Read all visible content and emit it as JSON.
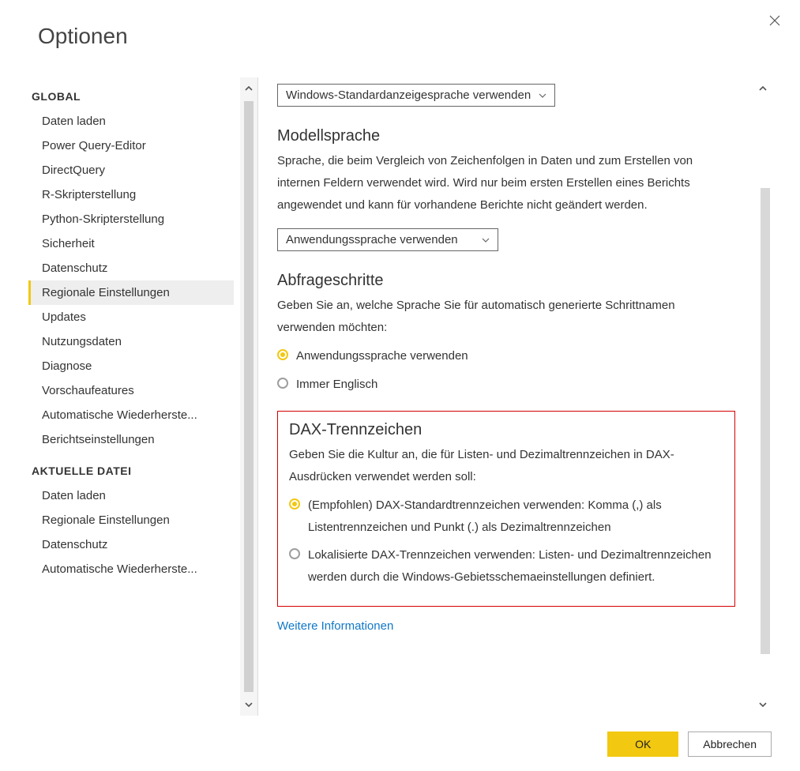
{
  "title": "Optionen",
  "sidebar": {
    "global_header": "GLOBAL",
    "global_items": [
      "Daten laden",
      "Power Query-Editor",
      "DirectQuery",
      "R-Skripterstellung",
      "Python-Skripterstellung",
      "Sicherheit",
      "Datenschutz",
      "Regionale Einstellungen",
      "Updates",
      "Nutzungsdaten",
      "Diagnose",
      "Vorschaufeatures",
      "Automatische Wiederherste...",
      "Berichtseinstellungen"
    ],
    "global_selected_index": 7,
    "file_header": "AKTUELLE DATEI",
    "file_items": [
      "Daten laden",
      "Regionale Einstellungen",
      "Datenschutz",
      "Automatische Wiederherste..."
    ]
  },
  "main": {
    "dropdown1": "Windows-Standardanzeigesprache verwenden",
    "model_heading": "Modellsprache",
    "model_desc": "Sprache, die beim Vergleich von Zeichenfolgen in Daten und zum Erstellen von internen Feldern verwendet wird. Wird nur beim ersten Erstellen eines Berichts angewendet und kann für vorhandene Berichte nicht geändert werden.",
    "dropdown2": "Anwendungssprache verwenden",
    "steps_heading": "Abfrageschritte",
    "steps_desc": "Geben Sie an, welche Sprache Sie für automatisch generierte Schrittnamen verwenden möchten:",
    "steps_radio1": "Anwendungssprache verwenden",
    "steps_radio2": "Immer Englisch",
    "dax_heading": "DAX-Trennzeichen",
    "dax_desc": "Geben Sie die Kultur an, die für Listen- und Dezimaltrennzeichen in DAX-Ausdrücken verwendet werden soll:",
    "dax_radio1": "(Empfohlen) DAX-Standardtrennzeichen verwenden: Komma (,) als Listentrennzeichen und Punkt (.) als Dezimaltrennzeichen",
    "dax_radio2": "Lokalisierte DAX-Trennzeichen verwenden: Listen- und Dezimaltrennzeichen werden durch die Windows-Gebietsschemaeinstellungen definiert.",
    "more_info": "Weitere Informationen"
  },
  "footer": {
    "ok": "OK",
    "cancel": "Abbrechen"
  }
}
